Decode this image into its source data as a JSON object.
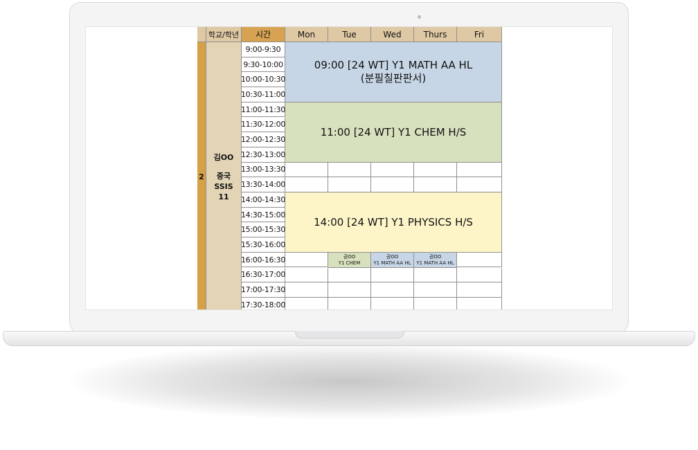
{
  "header": {
    "col_empty": "",
    "school_grade": "학교/학년",
    "time": "시간",
    "days": [
      "Mon",
      "Tue",
      "Wed",
      "Thurs",
      "Fri"
    ]
  },
  "student": {
    "number": "2",
    "name": "김OO",
    "country": "중국",
    "school": "SSIS",
    "grade": "11"
  },
  "time_slots": [
    "9:00-9:30",
    "9:30-10:00",
    "10:00-10:30",
    "10:30-11:00",
    "11:00-11:30",
    "11:30-12:00",
    "12:00-12:30",
    "12:30-13:00",
    "13:00-13:30",
    "13:30-14:00",
    "14:00-14:30",
    "14:30-15:00",
    "15:00-15:30",
    "15:30-16:00",
    "16:00-16:30",
    "16:30-17:00",
    "17:00-17:30",
    "17:30-18:00"
  ],
  "events": {
    "math": {
      "line1": "09:00 [24 WT] Y1 MATH AA HL",
      "line2": "(분필칠판판서)",
      "color": "#c7d6e6"
    },
    "chem": {
      "line1": "11:00 [24 WT] Y1 CHEM H/S",
      "color": "#d7e1bd"
    },
    "physics": {
      "line1": "14:00 [24 WT] Y1 PHYSICS H/S",
      "color": "#fdf5c8"
    }
  },
  "mini_events": {
    "tue": {
      "name": "권OO",
      "course": "Y1 CHEM",
      "color": "#d7e1bd"
    },
    "wed": {
      "name": "권OO",
      "course": "Y1 MATH AA HL",
      "color": "#c7d6e6"
    },
    "thu": {
      "name": "권OO",
      "course": "Y1 MATH AA HL",
      "color": "#c7d6e6"
    }
  }
}
